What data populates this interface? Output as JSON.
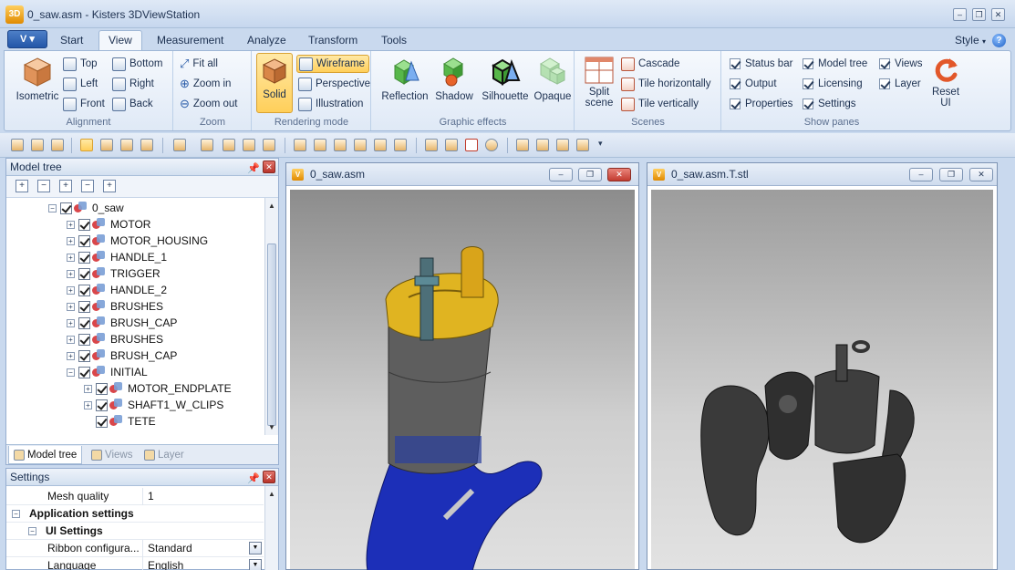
{
  "window": {
    "title": "0_saw.asm - Kisters 3DViewStation",
    "logo_text": "3D",
    "minimize": "–",
    "maximize": "❐",
    "close": "✕"
  },
  "ribbon_tabs": [
    {
      "label": "Start"
    },
    {
      "label": "View"
    },
    {
      "label": "Measurement"
    },
    {
      "label": "Analyze"
    },
    {
      "label": "Transform"
    },
    {
      "label": "Tools"
    }
  ],
  "style_menu": "Style",
  "help": "?",
  "ribbon": {
    "alignment": {
      "label": "Alignment",
      "isometric": "Isometric",
      "top": "Top",
      "bottom": "Bottom",
      "left": "Left",
      "right": "Right",
      "front": "Front",
      "back": "Back"
    },
    "zoom": {
      "label": "Zoom",
      "fit_all": "Fit all",
      "zoom_in": "Zoom in",
      "zoom_out": "Zoom out"
    },
    "rendering": {
      "label": "Rendering mode",
      "solid": "Solid",
      "wireframe": "Wireframe",
      "perspective": "Perspective",
      "illustration": "Illustration"
    },
    "effects": {
      "label": "Graphic effects",
      "reflection": "Reflection",
      "shadow": "Shadow",
      "silhouette": "Silhouette",
      "opaque": "Opaque"
    },
    "scenes": {
      "label": "Scenes",
      "split_line1": "Split",
      "split_line2": "scene",
      "cascade": "Cascade",
      "tile_h": "Tile horizontally",
      "tile_v": "Tile vertically"
    },
    "show_panes": {
      "label": "Show panes",
      "status_bar": "Status bar",
      "output": "Output",
      "properties": "Properties",
      "model_tree": "Model tree",
      "licensing": "Licensing",
      "settings": "Settings",
      "views": "Views",
      "layer": "Layer"
    },
    "reset_ui_line1": "Reset",
    "reset_ui_line2": "UI"
  },
  "model_tree": {
    "title": "Model tree",
    "root": "0_saw",
    "items": [
      {
        "label": "MOTOR"
      },
      {
        "label": "MOTOR_HOUSING"
      },
      {
        "label": "HANDLE_1"
      },
      {
        "label": "TRIGGER"
      },
      {
        "label": "HANDLE_2"
      },
      {
        "label": "BRUSHES"
      },
      {
        "label": "BRUSH_CAP"
      },
      {
        "label": "BRUSHES"
      },
      {
        "label": "BRUSH_CAP"
      },
      {
        "label": "INITIAL"
      },
      {
        "label": "MOTOR_ENDPLATE"
      },
      {
        "label": "SHAFT1_W_CLIPS"
      },
      {
        "label": "TETE"
      }
    ],
    "tabs": [
      {
        "label": "Model tree"
      },
      {
        "label": "Views"
      },
      {
        "label": "Layer"
      }
    ]
  },
  "settings": {
    "title": "Settings",
    "rows": [
      {
        "name": "Mesh quality",
        "value": "1"
      },
      {
        "name": "Application settings",
        "value": ""
      },
      {
        "name": "UI Settings",
        "value": ""
      },
      {
        "name": "Ribbon configura...",
        "value": "Standard"
      },
      {
        "name": "Language",
        "value": "English"
      }
    ]
  },
  "viewports": [
    {
      "title": "0_saw.asm"
    },
    {
      "title": "0_saw.asm.T.stl"
    }
  ]
}
